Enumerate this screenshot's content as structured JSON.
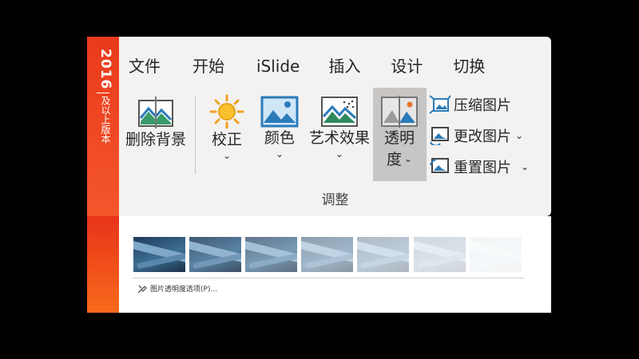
{
  "version_badge": {
    "year": "2016",
    "note": "及以上版本"
  },
  "tabs": [
    "文件",
    "开始",
    "iSlide",
    "插入",
    "设计",
    "切换"
  ],
  "tools": {
    "remove_background": "删除背景",
    "corrections": "校正",
    "color": "颜色",
    "artistic_effects": "艺术效果",
    "transparency_line1": "透明",
    "transparency_line2": "度"
  },
  "side_commands": {
    "compress": "压缩图片",
    "change": "更改图片",
    "reset": "重置图片"
  },
  "group_label": "调整",
  "transparency_presets": [
    0,
    15,
    30,
    50,
    65,
    80,
    95
  ],
  "options_link": "图片透明度选项(P)...",
  "colors": {
    "accent_orange": "#f4562a",
    "ribbon_bg": "#f3f2f1",
    "selected_bg": "#c8c6c4"
  }
}
